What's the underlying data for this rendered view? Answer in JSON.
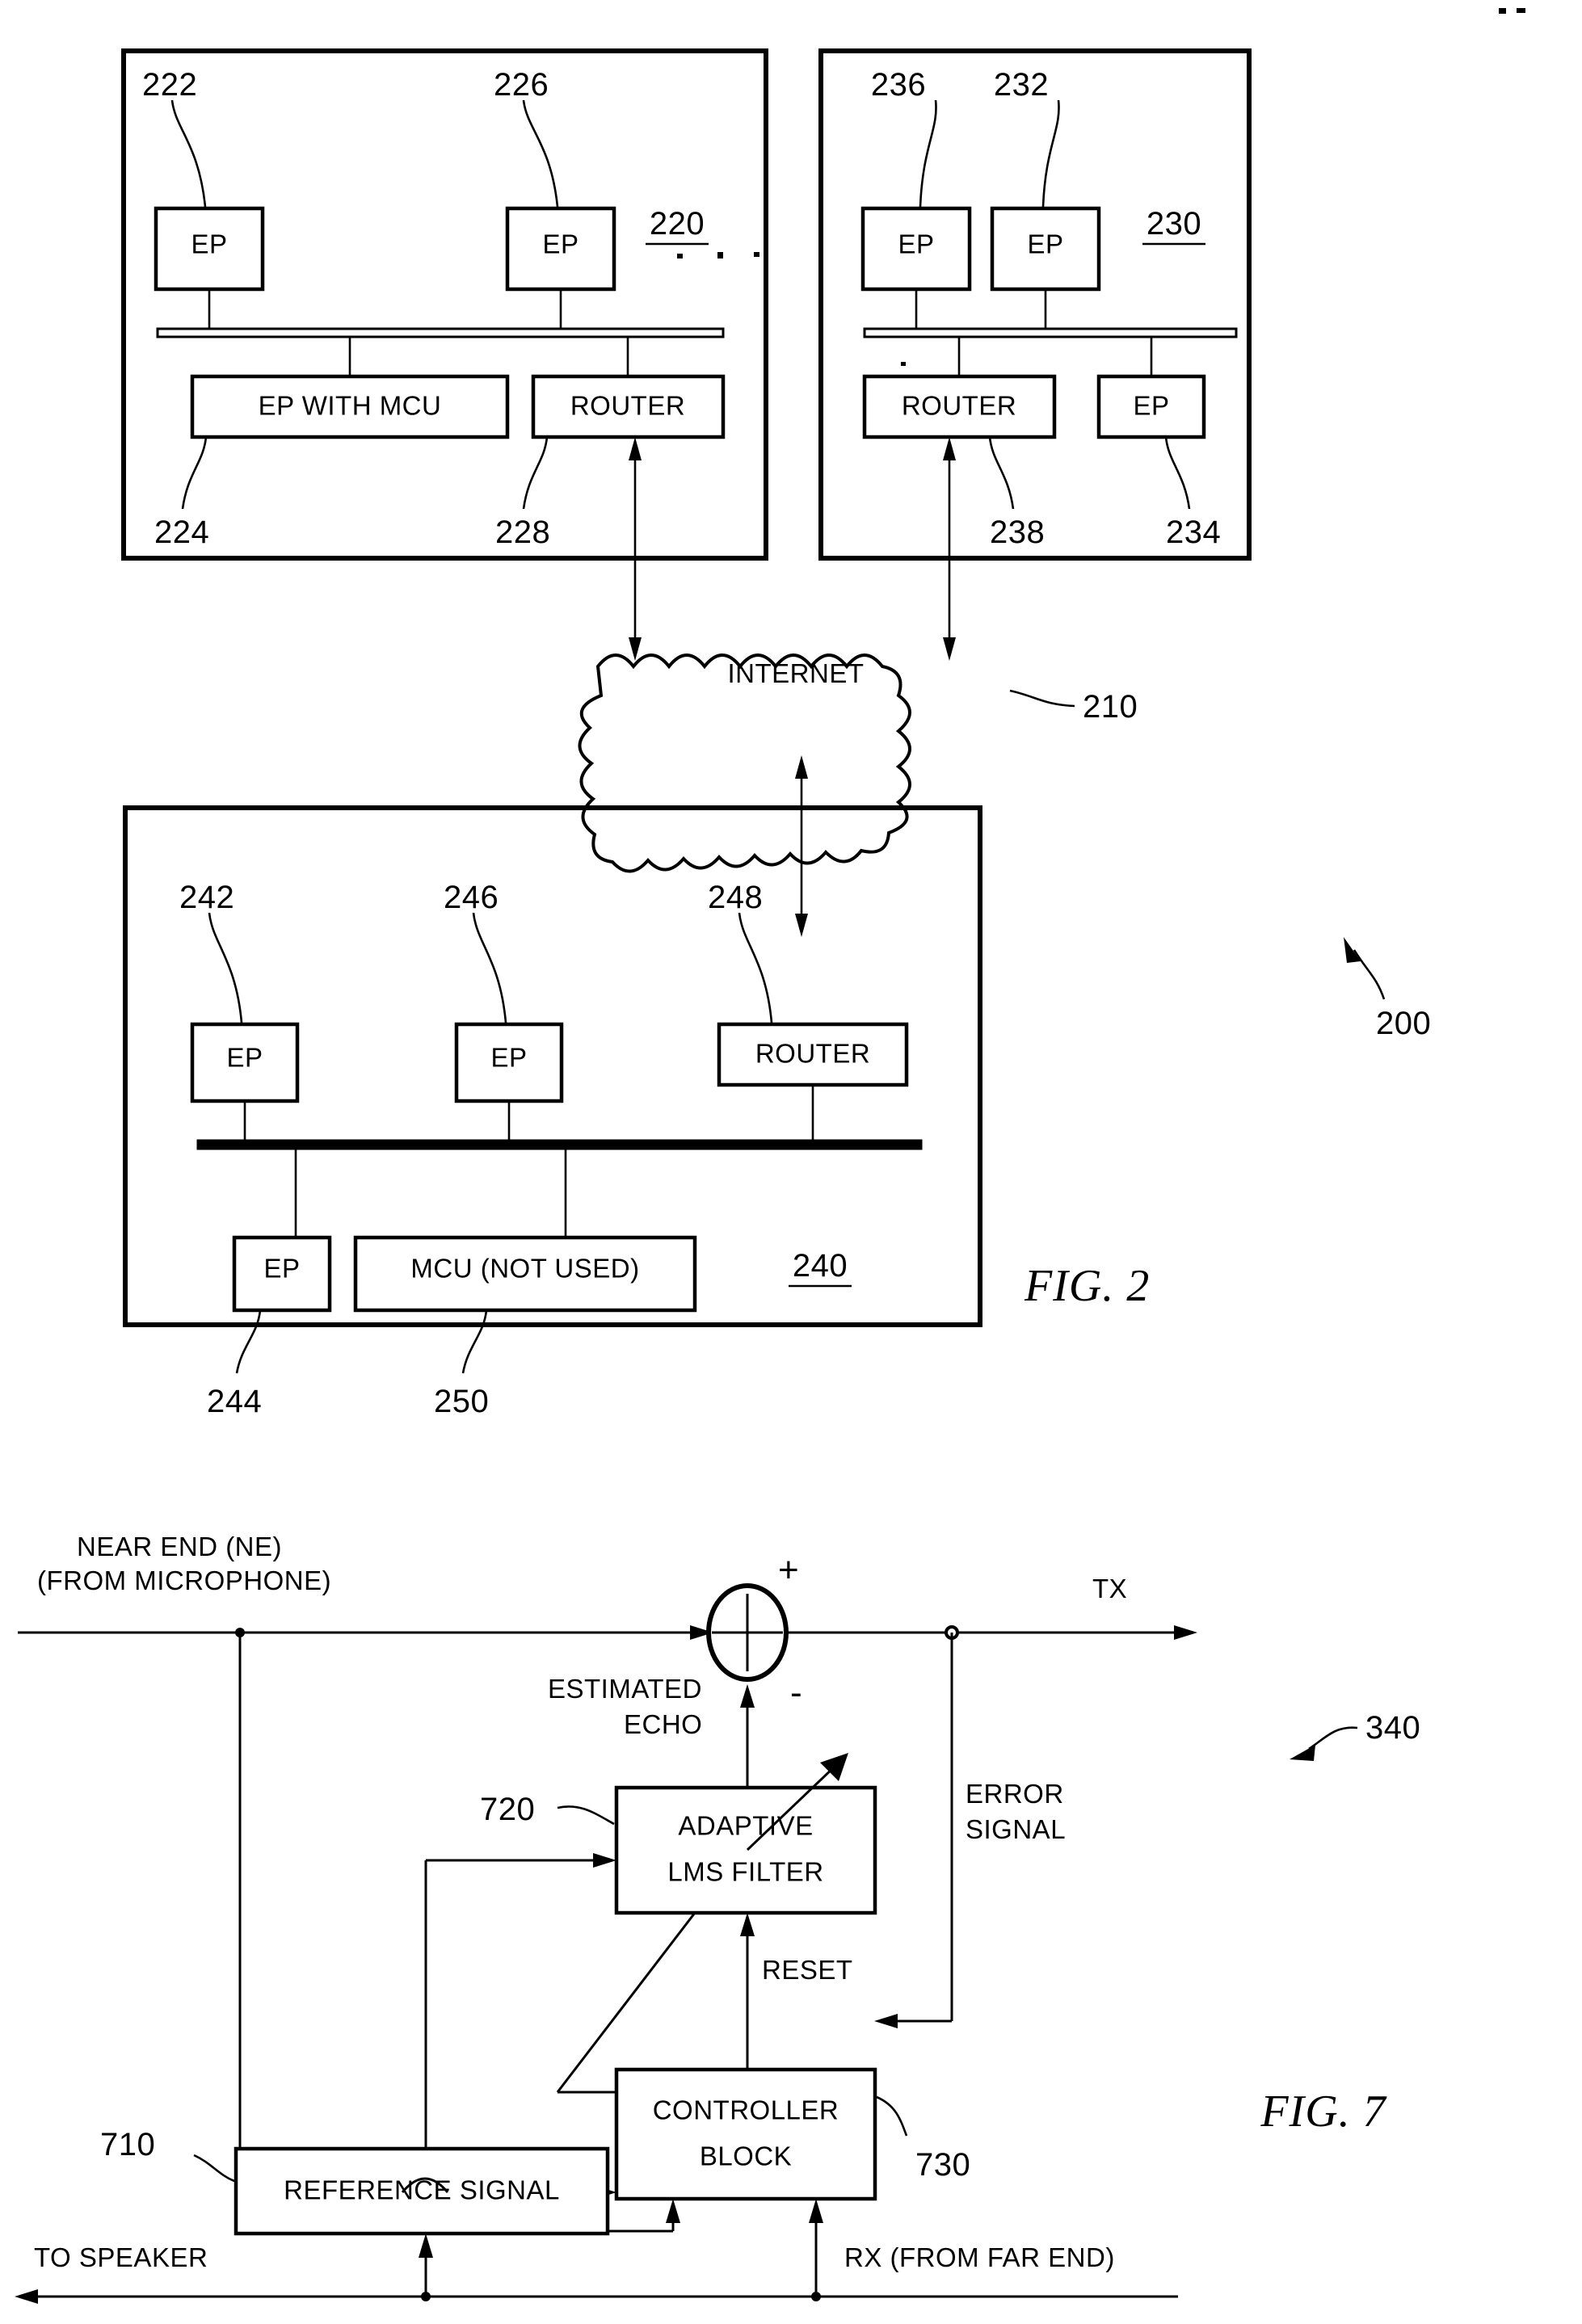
{
  "page": {
    "sheet_marks": 2
  },
  "fig2": {
    "caption": "FIG. 2",
    "system_ref": "200",
    "network": {
      "cloud_label": "INTERNET",
      "cloud_ref": "210"
    },
    "site_a": {
      "ref": "220",
      "nodes": [
        {
          "label": "EP",
          "ref": "222"
        },
        {
          "label": "EP",
          "ref": "226"
        },
        {
          "label": "EP WITH MCU",
          "ref": "224"
        },
        {
          "label": "ROUTER",
          "ref": "228"
        }
      ],
      "ellipsis": "..."
    },
    "site_b": {
      "ref": "230",
      "nodes": [
        {
          "label": "EP",
          "ref": "236"
        },
        {
          "label": "EP",
          "ref": "232"
        },
        {
          "label": "ROUTER",
          "ref": "238"
        },
        {
          "label": "EP",
          "ref": "234"
        }
      ]
    },
    "site_c": {
      "ref": "240",
      "nodes": [
        {
          "label": "EP",
          "ref": "242"
        },
        {
          "label": "EP",
          "ref": "246"
        },
        {
          "label": "ROUTER",
          "ref": "248"
        },
        {
          "label": "EP",
          "ref": "244"
        },
        {
          "label": "MCU (NOT USED)",
          "ref": "250"
        }
      ]
    }
  },
  "fig7": {
    "caption": "FIG. 7",
    "system_ref": "340",
    "inputs": {
      "near_end_line1": "NEAR END (NE)",
      "near_end_line2": "(FROM MICROPHONE)",
      "tx_label": "TX",
      "to_speaker": "TO SPEAKER",
      "rx_label": "RX (FROM FAR END)"
    },
    "summing": {
      "plus": "+",
      "minus": "-"
    },
    "signals": {
      "estimated_echo_line1": "ESTIMATED",
      "estimated_echo_line2": "ECHO",
      "error_signal_line1": "ERROR",
      "error_signal_line2": "SIGNAL",
      "reset": "RESET"
    },
    "blocks": [
      {
        "line1": "ADAPTIVE",
        "line2": "LMS FILTER",
        "ref": "720"
      },
      {
        "line1": "CONTROLLER",
        "line2": "BLOCK",
        "ref": "730"
      },
      {
        "line1": "REFERENCE SIGNAL",
        "line2": "",
        "ref": "710"
      }
    ]
  }
}
